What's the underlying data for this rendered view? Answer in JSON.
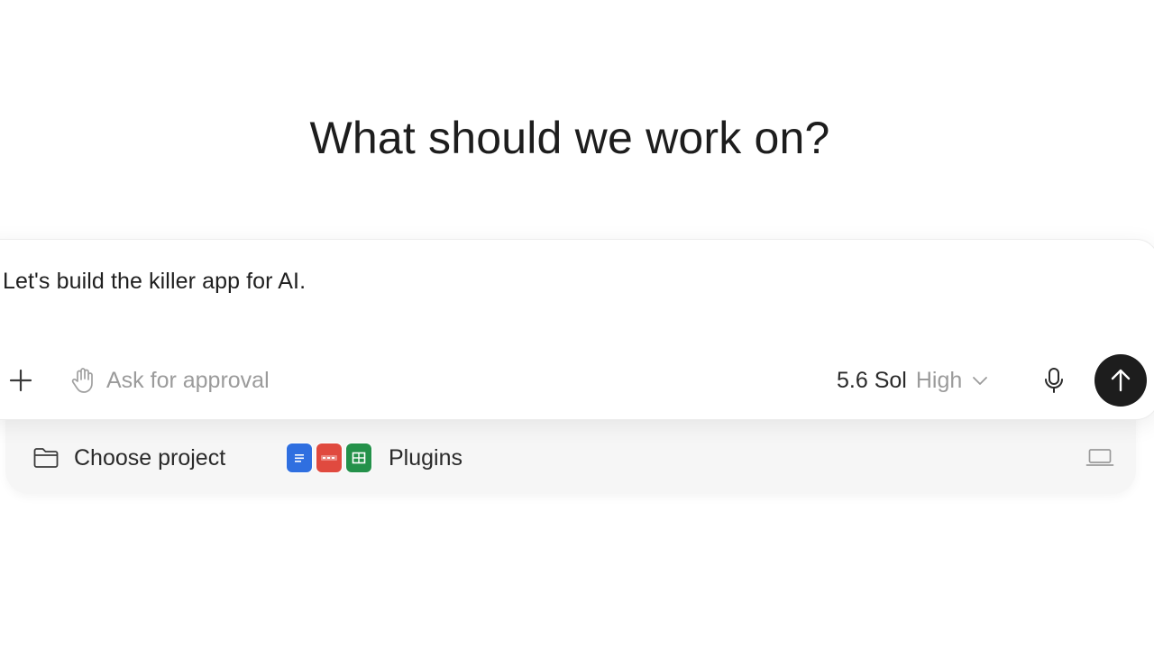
{
  "heading": "What should we work on?",
  "composer": {
    "prompt_text": "Let's build the killer app for AI.",
    "approval_label": "Ask for approval",
    "model_name": "5.6 Sol",
    "model_effort": "High"
  },
  "tray": {
    "project_label": "Choose project",
    "plugins_label": "Plugins",
    "plugin_icons": [
      "docs-icon",
      "pdf-icon",
      "sheets-icon"
    ]
  },
  "icons": {
    "plus": "plus-icon",
    "approval": "hand-icon",
    "chevron": "chevron-down-icon",
    "mic": "microphone-icon",
    "send": "arrow-up-icon",
    "folder": "folder-icon",
    "laptop": "laptop-icon"
  },
  "colors": {
    "send_button": "#1d1d1d",
    "docs": "#2f6fe0",
    "pdf": "#e04a3f",
    "sheets": "#24914a",
    "muted_text": "#9b9b9b",
    "tray_bg": "#f6f6f6"
  }
}
